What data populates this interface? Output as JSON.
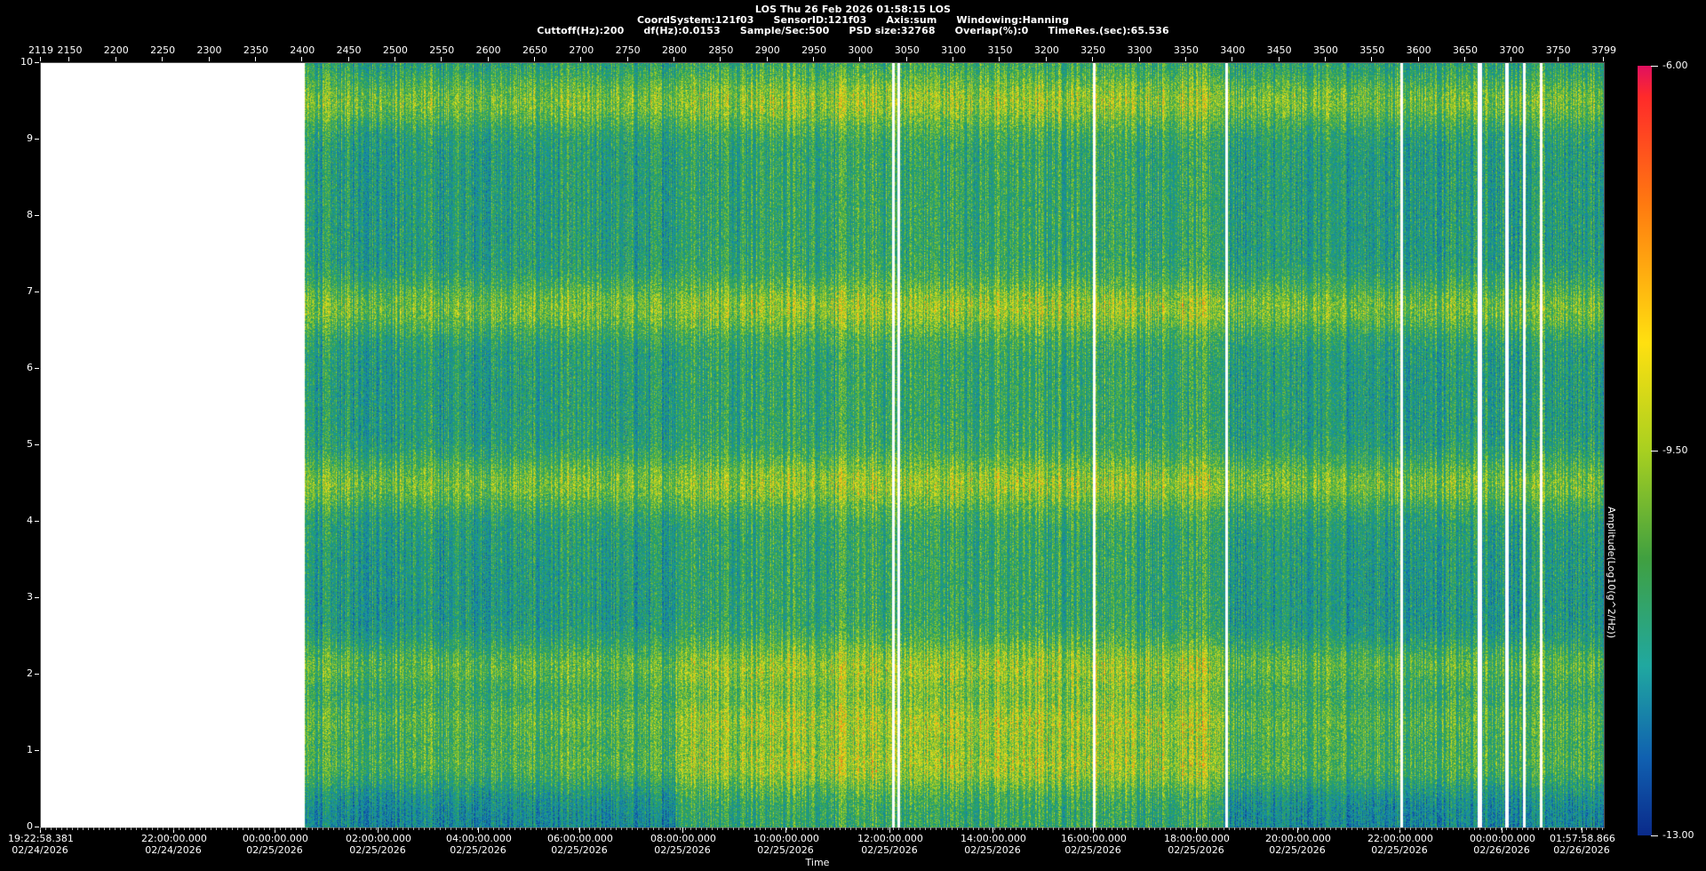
{
  "header": {
    "line1": "LOS  Thu 26 Feb 2026 01:58:15  LOS",
    "line2": [
      "CoordSystem:121f03",
      "SensorID:121f03",
      "Axis:sum",
      "Windowing:Hanning"
    ],
    "line3": [
      "Cuttoff(Hz):200",
      "df(Hz):0.0153",
      "Sample/Sec:500",
      "PSD size:32768",
      "Overlap(%):0",
      "TimeRes.(sec):65.536"
    ]
  },
  "chart_data": {
    "type": "heatmap",
    "title": "LOS  Thu 26 Feb 2026 01:58:15  LOS",
    "xlabel": "Time",
    "ylabel": "",
    "colorbar_label": "Amplitude(Log10(g^2/Hz))",
    "ylim": [
      0,
      10
    ],
    "y_ticks": [
      "0",
      "1",
      "2",
      "3",
      "4",
      "5",
      "6",
      "7",
      "8",
      "9",
      "10"
    ],
    "top_axis_range": [
      2119,
      3799
    ],
    "top_ticks": [
      "2119",
      "2150",
      "2200",
      "2250",
      "2300",
      "2350",
      "2400",
      "2450",
      "2500",
      "2550",
      "2600",
      "2650",
      "2700",
      "2750",
      "2800",
      "2850",
      "2900",
      "2950",
      "3000",
      "3050",
      "3100",
      "3150",
      "3200",
      "3250",
      "3300",
      "3350",
      "3400",
      "3450",
      "3500",
      "3550",
      "3600",
      "3650",
      "3700",
      "3750",
      "3799"
    ],
    "time_ticks": [
      {
        "time": "19:22:58.381",
        "date": "02/24/2026"
      },
      {
        "time": "22:00:00.000",
        "date": "02/24/2026"
      },
      {
        "time": "00:00:00.000",
        "date": "02/25/2026"
      },
      {
        "time": "02:00:00.000",
        "date": "02/25/2026"
      },
      {
        "time": "04:00:00.000",
        "date": "02/25/2026"
      },
      {
        "time": "06:00:00.000",
        "date": "02/25/2026"
      },
      {
        "time": "08:00:00.000",
        "date": "02/25/2026"
      },
      {
        "time": "10:00:00.000",
        "date": "02/25/2026"
      },
      {
        "time": "12:00:00.000",
        "date": "02/25/2026"
      },
      {
        "time": "14:00:00.000",
        "date": "02/25/2026"
      },
      {
        "time": "16:00:00.000",
        "date": "02/25/2026"
      },
      {
        "time": "18:00:00.000",
        "date": "02/25/2026"
      },
      {
        "time": "20:00:00.000",
        "date": "02/25/2026"
      },
      {
        "time": "22:00:00.000",
        "date": "02/25/2026"
      },
      {
        "time": "00:00:00.000",
        "date": "02/26/2026"
      },
      {
        "time": "01:57:58.866",
        "date": "02/26/2026"
      }
    ],
    "colorbar": {
      "min": -13.0,
      "max": -6.0,
      "ticks": [
        "-6.00",
        "-9.50",
        "-13.00"
      ]
    },
    "no_data_until_top_x": 2400,
    "gap_columns_top_x": [
      2400,
      3034,
      3040,
      3250,
      3392,
      3580,
      3663,
      3665,
      3693,
      3694,
      3712,
      3730
    ],
    "hot_bands_hz": [
      0.8,
      1.4,
      2.1,
      4.5,
      6.8,
      9.5
    ],
    "active_periods_top_x": [
      [
        2800,
        3390
      ]
    ]
  },
  "colors": {
    "background": "#000000",
    "text": "#ffffff",
    "nodata": "#ffffff"
  }
}
